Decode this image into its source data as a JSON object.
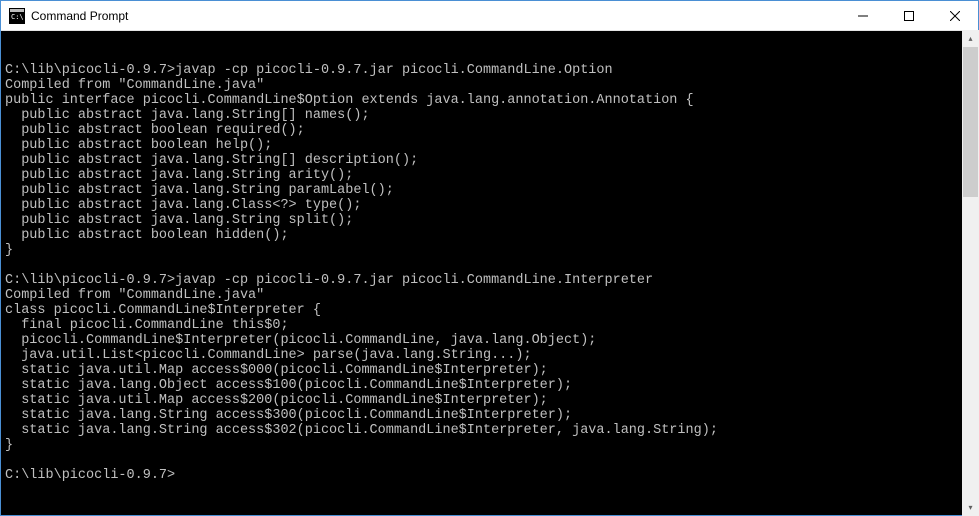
{
  "window": {
    "title": "Command Prompt"
  },
  "terminal": {
    "lines": [
      "",
      "C:\\lib\\picocli-0.9.7>javap -cp picocli-0.9.7.jar picocli.CommandLine.Option",
      "Compiled from \"CommandLine.java\"",
      "public interface picocli.CommandLine$Option extends java.lang.annotation.Annotation {",
      "  public abstract java.lang.String[] names();",
      "  public abstract boolean required();",
      "  public abstract boolean help();",
      "  public abstract java.lang.String[] description();",
      "  public abstract java.lang.String arity();",
      "  public abstract java.lang.String paramLabel();",
      "  public abstract java.lang.Class<?> type();",
      "  public abstract java.lang.String split();",
      "  public abstract boolean hidden();",
      "}",
      "",
      "C:\\lib\\picocli-0.9.7>javap -cp picocli-0.9.7.jar picocli.CommandLine.Interpreter",
      "Compiled from \"CommandLine.java\"",
      "class picocli.CommandLine$Interpreter {",
      "  final picocli.CommandLine this$0;",
      "  picocli.CommandLine$Interpreter(picocli.CommandLine, java.lang.Object);",
      "  java.util.List<picocli.CommandLine> parse(java.lang.String...);",
      "  static java.util.Map access$000(picocli.CommandLine$Interpreter);",
      "  static java.lang.Object access$100(picocli.CommandLine$Interpreter);",
      "  static java.util.Map access$200(picocli.CommandLine$Interpreter);",
      "  static java.lang.String access$300(picocli.CommandLine$Interpreter);",
      "  static java.lang.String access$302(picocli.CommandLine$Interpreter, java.lang.String);",
      "}",
      "",
      "C:\\lib\\picocli-0.9.7>"
    ]
  }
}
